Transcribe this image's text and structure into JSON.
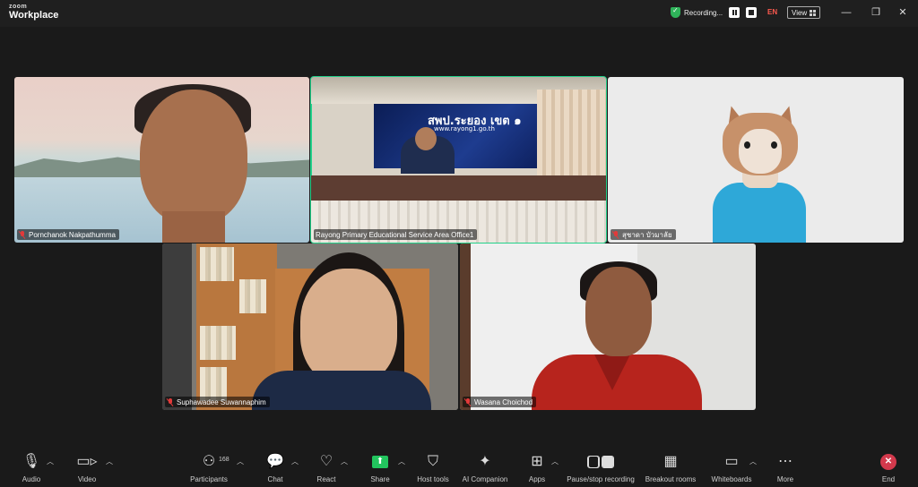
{
  "titlebar": {
    "brand_top": "zoom",
    "brand_name": "Workplace",
    "recording_label": "Recording...",
    "language": "EN",
    "view_label": "View",
    "minimize": "—",
    "restore": "❐",
    "close": "✕"
  },
  "tiles": [
    {
      "name": "Pornchanok Nakpathumma",
      "muted": true,
      "active": false
    },
    {
      "name": "Rayong Primary Educational Service Area Office1",
      "muted": false,
      "active": true,
      "board_text": "สพป.ระยอง เขต ๑",
      "board_url": "www.rayong1.go.th"
    },
    {
      "name": "สุชาดา บัวมาลัย",
      "muted": true,
      "active": false
    },
    {
      "name": "Suphawadee Suwannaphim",
      "muted": true,
      "active": false
    },
    {
      "name": "Wasana Choichod",
      "muted": true,
      "active": false
    }
  ],
  "toolbar": {
    "audio": "Audio",
    "video": "Video",
    "participants": "Participants",
    "participants_count": "168",
    "chat": "Chat",
    "react": "React",
    "share": "Share",
    "host_tools": "Host tools",
    "ai_companion": "AI Companion",
    "apps": "Apps",
    "pause_stop_recording": "Pause/stop recording",
    "breakout_rooms": "Breakout rooms",
    "whiteboards": "Whiteboards",
    "more": "More",
    "end": "End"
  },
  "colors": {
    "active_speaker_border": "#23d18b",
    "share_accent": "#22c55e",
    "end_button": "#d3394c",
    "recording_shield": "#2fb35a",
    "language_indicator": "#ff5a4f"
  }
}
